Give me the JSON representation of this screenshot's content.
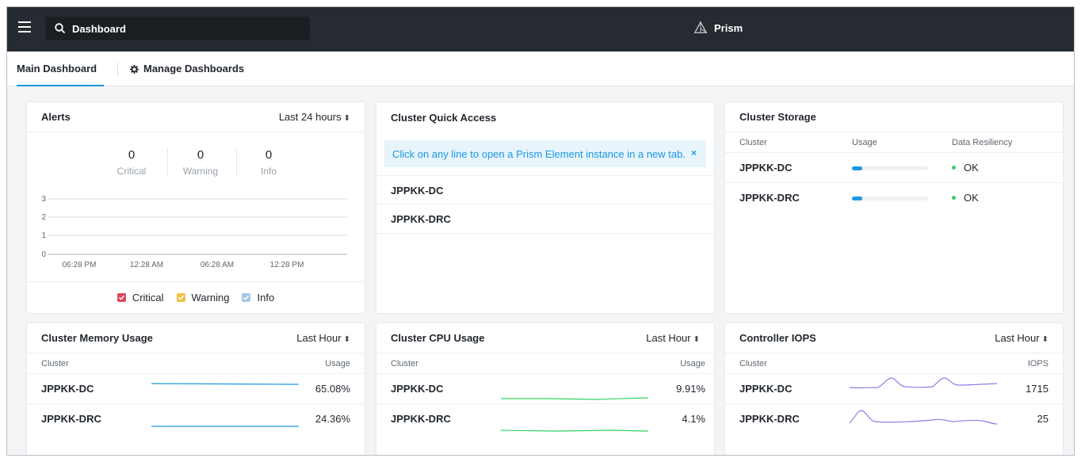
{
  "topbar": {
    "search_value": "Dashboard",
    "brand": "Prism",
    "colors": {
      "bar": "#262b31",
      "accent": "#1b98e0"
    }
  },
  "tabs": [
    {
      "label": "Main Dashboard",
      "active": true
    },
    {
      "label": "Manage Dashboards",
      "active": false
    }
  ],
  "alerts": {
    "title": "Alerts",
    "range": "Last 24 hours",
    "counts": [
      {
        "value": "0",
        "label": "Critical"
      },
      {
        "value": "0",
        "label": "Warning"
      },
      {
        "value": "0",
        "label": "Info"
      }
    ],
    "y_ticks": [
      "3",
      "2",
      "1",
      "0"
    ],
    "x_ticks": [
      "06:28 PM",
      "12:28 AM",
      "06:28 AM",
      "12:28 PM"
    ],
    "legend": [
      {
        "label": "Critical",
        "color": "#e0475b"
      },
      {
        "label": "Warning",
        "color": "#f2c04a"
      },
      {
        "label": "Info",
        "color": "#a8c6e6"
      }
    ]
  },
  "quick_access": {
    "title": "Cluster Quick Access",
    "banner": "Click on any line to open a Prism Element instance in a new tab.",
    "close_glyph": "×",
    "clusters": [
      "JPPKK-DC",
      "JPPKK-DRC"
    ]
  },
  "storage": {
    "title": "Cluster Storage",
    "headers": {
      "cluster": "Cluster",
      "usage": "Usage",
      "resiliency": "Data Resiliency"
    },
    "rows": [
      {
        "cluster": "JPPKK-DC",
        "usage_fraction": 0.14,
        "resiliency": "OK"
      },
      {
        "cluster": "JPPKK-DRC",
        "usage_fraction": 0.14,
        "resiliency": "OK"
      }
    ]
  },
  "memory": {
    "title": "Cluster Memory Usage",
    "range": "Last Hour",
    "headers": {
      "cluster": "Cluster",
      "usage": "Usage"
    },
    "rows": [
      {
        "cluster": "JPPKK-DC",
        "value": "65.08%"
      },
      {
        "cluster": "JPPKK-DRC",
        "value": "24.36%"
      }
    ]
  },
  "cpu": {
    "title": "Cluster CPU Usage",
    "range": "Last Hour",
    "headers": {
      "cluster": "Cluster",
      "usage": "Usage"
    },
    "rows": [
      {
        "cluster": "JPPKK-DC",
        "value": "9.91%"
      },
      {
        "cluster": "JPPKK-DRC",
        "value": "4.1%"
      }
    ]
  },
  "iops": {
    "title": "Controller IOPS",
    "range": "Last Hour",
    "headers": {
      "cluster": "Cluster",
      "iops": "IOPS"
    },
    "rows": [
      {
        "cluster": "JPPKK-DC",
        "value": "1715"
      },
      {
        "cluster": "JPPKK-DRC",
        "value": "25"
      }
    ]
  },
  "range_arrows": "⬍"
}
